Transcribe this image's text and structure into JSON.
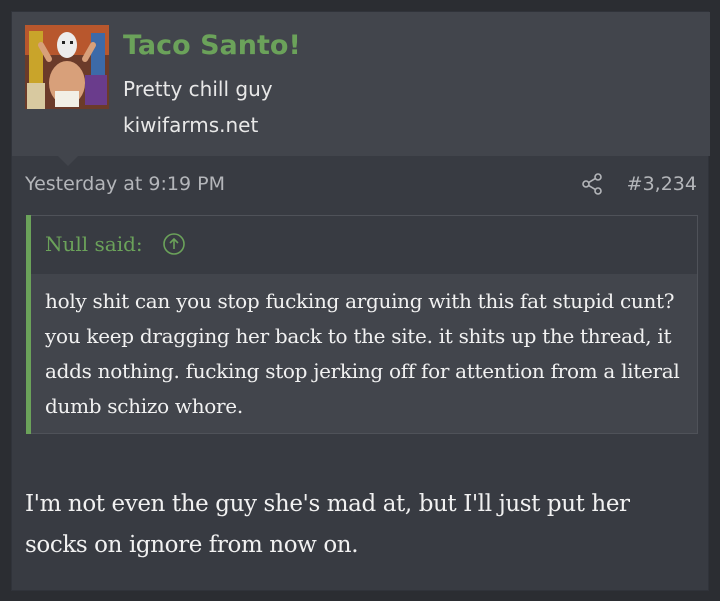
{
  "user": {
    "name": "Taco Santo!",
    "title": "Pretty chill guy",
    "site": "kiwifarms.net",
    "avatar_icon": "avatar-luchador-image"
  },
  "post": {
    "date": "Yesterday at 9:19 PM",
    "number": "#3,234",
    "share_icon": "share-icon"
  },
  "quote": {
    "author": "Null said:",
    "jump_icon": "arrow-up-circle-icon",
    "text": "holy shit can you stop fucking arguing with this fat stupid cunt? you keep dragging her back to the site. it shits up the thread, it adds nothing. fucking stop jerking off for attention from a literal dumb schizo whore."
  },
  "message": {
    "text": "I'm not even the guy she's mad at, but I'll just put her socks on ignore from now on."
  },
  "colors": {
    "accent": "#6ba25a",
    "background": "#383b42",
    "header": "#42454c"
  }
}
